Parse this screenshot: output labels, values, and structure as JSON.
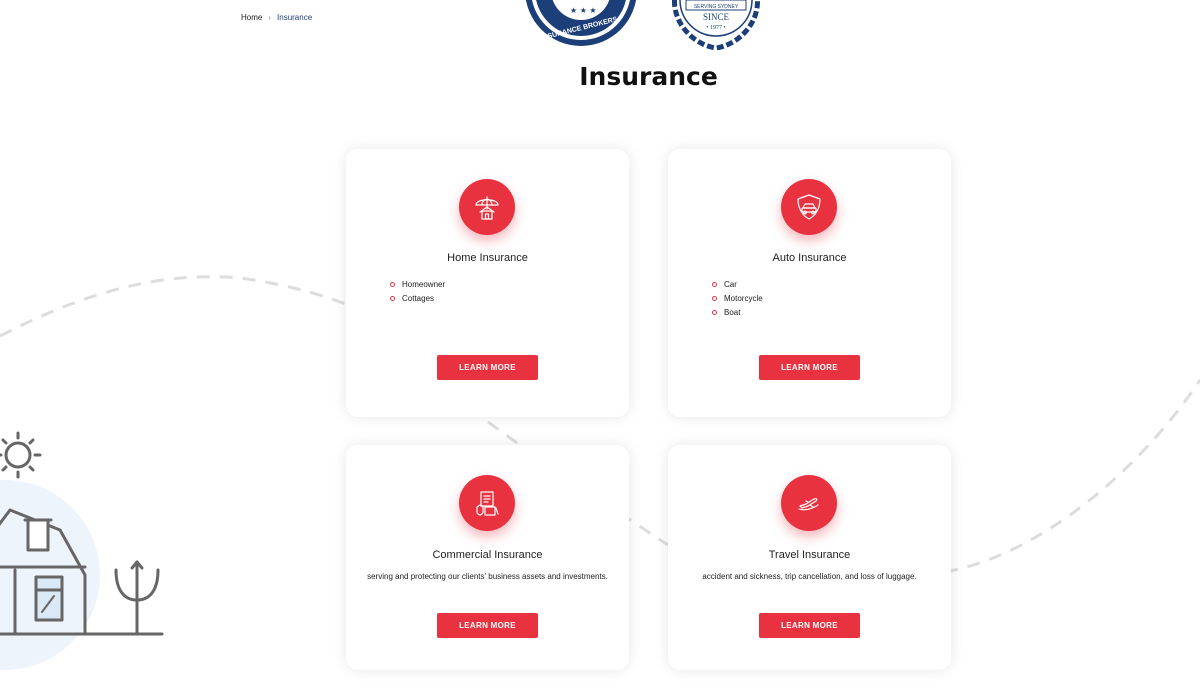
{
  "breadcrumb": {
    "home": "Home",
    "current": "Insurance"
  },
  "badges": {
    "left_text": "INSURANCE BROKERS",
    "right_top": "SERVING SYDNEY",
    "right_since": "SINCE",
    "right_year": "• 1977 •"
  },
  "page": {
    "title": "Insurance"
  },
  "cards": [
    {
      "icon": "umbrella-house-icon",
      "title": "Home Insurance",
      "items": [
        "Homeowner",
        "Cottages"
      ],
      "button": "LEARN MORE"
    },
    {
      "icon": "car-shield-icon",
      "title": "Auto Insurance",
      "items": [
        "Car",
        "Motorcycle",
        "Boat"
      ],
      "button": "LEARN MORE"
    },
    {
      "icon": "business-documents-icon",
      "title": "Commercial Insurance",
      "description": "serving and protecting our clients' business assets and investments.",
      "button": "LEARN MORE"
    },
    {
      "icon": "airplane-hand-icon",
      "title": "Travel Insurance",
      "description": "accident and sickness, trip cancellation, and loss of luggage.",
      "button": "LEARN MORE"
    }
  ],
  "colors": {
    "accent": "#e8323f",
    "brand_navy": "#1c3f7a",
    "dashed_line": "#dddddd",
    "illustration_gray": "#666666"
  }
}
